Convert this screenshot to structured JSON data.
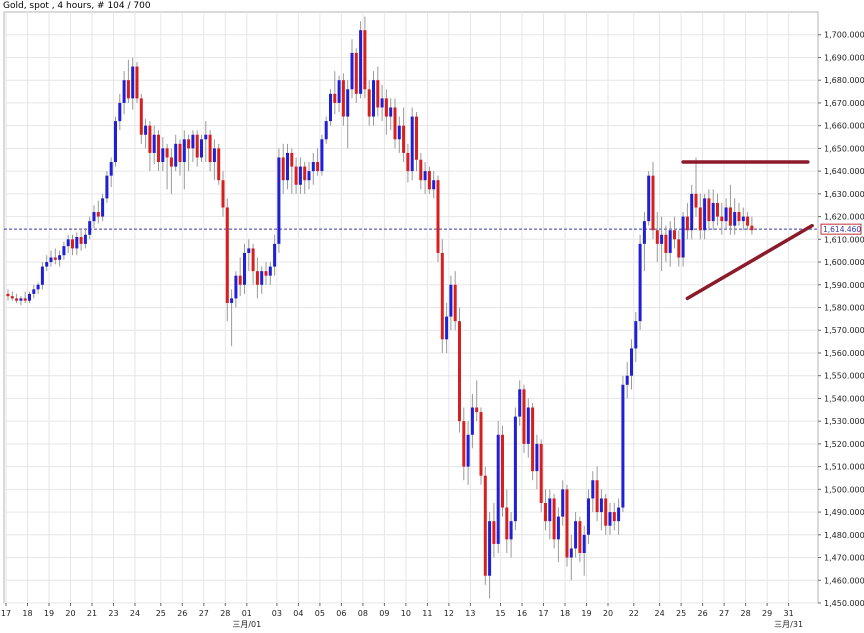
{
  "title": "Gold, spot , 4 hours, # 104 / 700",
  "colors": {
    "up": "#1f1fd6",
    "down": "#d81f1f",
    "wick": "#9a9a9a",
    "grid": "#e6e6e6",
    "price_line": "#3a3aa8",
    "trendline": "#8b1a2a",
    "current_label_border": "#c0303a"
  },
  "chart_data": {
    "type": "candlestick",
    "y_range": [
      1450,
      1710
    ],
    "y_ticks": [
      1450,
      1460,
      1470,
      1480,
      1490,
      1500,
      1510,
      1520,
      1530,
      1540,
      1550,
      1560,
      1570,
      1580,
      1590,
      1600,
      1610,
      1620,
      1630,
      1640,
      1650,
      1660,
      1670,
      1680,
      1690,
      1700
    ],
    "y_tick_labels": [
      "1,450.000",
      "1,460.000",
      "1,470.000",
      "1,480.000",
      "1,490.000",
      "1,500.000",
      "1,510.000",
      "1,520.000",
      "1,530.000",
      "1,540.000",
      "1,550.000",
      "1,560.000",
      "1,570.000",
      "1,580.000",
      "1,590.000",
      "1,600.000",
      "1,610.000",
      "1,620.000",
      "1,630.000",
      "1,640.000",
      "1,650.000",
      "1,660.000",
      "1,670.000",
      "1,680.000",
      "1,690.000",
      "1,700.000"
    ],
    "current_price": 1614.46,
    "current_price_label": "1,614.460",
    "x_day_labels": [
      "17",
      "18",
      "19",
      "20",
      "21",
      "23",
      "24",
      "25",
      "26",
      "27",
      "28",
      "01",
      "03",
      "04",
      "05",
      "06",
      "08",
      "09",
      "10",
      "11",
      "12",
      "13",
      "15",
      "16",
      "17",
      "18",
      "19",
      "20",
      "22",
      "24",
      "25",
      "26",
      "27",
      "28",
      "29",
      "31"
    ],
    "x_day_bar_index": [
      0,
      5,
      10,
      15,
      20,
      25,
      30,
      36,
      41,
      46,
      51,
      56,
      63,
      68,
      73,
      78,
      83,
      88,
      93,
      98,
      103,
      108,
      115,
      120,
      125,
      130,
      135,
      140,
      146,
      152,
      157,
      162,
      167,
      172,
      177,
      182
    ],
    "month_labels": [
      {
        "text": "三月/01",
        "bar": 56
      },
      {
        "text": "三月/31",
        "bar": 182
      }
    ],
    "bar_spacing_px": 4.3,
    "candles_ohlc": [
      [
        1586,
        1588,
        1583,
        1585
      ],
      [
        1585,
        1587,
        1583,
        1584
      ],
      [
        1584,
        1586,
        1582,
        1583
      ],
      [
        1583,
        1585,
        1581,
        1584
      ],
      [
        1584,
        1587,
        1582,
        1583
      ],
      [
        1583,
        1587,
        1582,
        1586
      ],
      [
        1586,
        1590,
        1584,
        1588
      ],
      [
        1588,
        1591,
        1586,
        1590
      ],
      [
        1590,
        1600,
        1588,
        1598
      ],
      [
        1598,
        1603,
        1596,
        1600
      ],
      [
        1600,
        1605,
        1598,
        1602
      ],
      [
        1602,
        1606,
        1599,
        1601
      ],
      [
        1601,
        1605,
        1598,
        1603
      ],
      [
        1603,
        1609,
        1601,
        1607
      ],
      [
        1607,
        1612,
        1604,
        1610
      ],
      [
        1610,
        1612,
        1603,
        1606
      ],
      [
        1606,
        1613,
        1603,
        1611
      ],
      [
        1611,
        1614,
        1605,
        1608
      ],
      [
        1608,
        1615,
        1606,
        1612
      ],
      [
        1612,
        1620,
        1610,
        1618
      ],
      [
        1618,
        1625,
        1615,
        1622
      ],
      [
        1622,
        1627,
        1617,
        1620
      ],
      [
        1620,
        1630,
        1618,
        1628
      ],
      [
        1628,
        1640,
        1626,
        1638
      ],
      [
        1638,
        1646,
        1633,
        1644
      ],
      [
        1644,
        1664,
        1642,
        1662
      ],
      [
        1662,
        1674,
        1658,
        1670
      ],
      [
        1670,
        1684,
        1665,
        1680
      ],
      [
        1680,
        1689,
        1670,
        1672
      ],
      [
        1672,
        1690,
        1667,
        1686
      ],
      [
        1686,
        1688,
        1670,
        1672
      ],
      [
        1672,
        1674,
        1652,
        1656
      ],
      [
        1656,
        1663,
        1650,
        1660
      ],
      [
        1660,
        1662,
        1640,
        1648
      ],
      [
        1648,
        1660,
        1643,
        1656
      ],
      [
        1656,
        1658,
        1640,
        1644
      ],
      [
        1644,
        1655,
        1640,
        1650
      ],
      [
        1650,
        1652,
        1632,
        1646
      ],
      [
        1646,
        1650,
        1630,
        1642
      ],
      [
        1642,
        1656,
        1640,
        1652
      ],
      [
        1652,
        1654,
        1638,
        1644
      ],
      [
        1644,
        1658,
        1632,
        1654
      ],
      [
        1654,
        1656,
        1640,
        1650
      ],
      [
        1650,
        1658,
        1644,
        1656
      ],
      [
        1656,
        1658,
        1642,
        1646
      ],
      [
        1646,
        1656,
        1644,
        1654
      ],
      [
        1654,
        1662,
        1644,
        1656
      ],
      [
        1656,
        1658,
        1640,
        1644
      ],
      [
        1644,
        1654,
        1636,
        1650
      ],
      [
        1650,
        1652,
        1634,
        1636
      ],
      [
        1636,
        1640,
        1620,
        1624
      ],
      [
        1624,
        1628,
        1574,
        1582
      ],
      [
        1582,
        1588,
        1563,
        1584
      ],
      [
        1584,
        1596,
        1580,
        1594
      ],
      [
        1594,
        1602,
        1585,
        1590
      ],
      [
        1590,
        1608,
        1586,
        1604
      ],
      [
        1604,
        1610,
        1596,
        1606
      ],
      [
        1606,
        1608,
        1590,
        1596
      ],
      [
        1596,
        1602,
        1584,
        1590
      ],
      [
        1590,
        1598,
        1586,
        1596
      ],
      [
        1596,
        1600,
        1590,
        1594
      ],
      [
        1594,
        1600,
        1590,
        1598
      ],
      [
        1598,
        1612,
        1594,
        1608
      ],
      [
        1608,
        1650,
        1604,
        1646
      ],
      [
        1646,
        1652,
        1630,
        1636
      ],
      [
        1636,
        1652,
        1632,
        1648
      ],
      [
        1648,
        1650,
        1630,
        1642
      ],
      [
        1642,
        1646,
        1630,
        1634
      ],
      [
        1634,
        1646,
        1630,
        1642
      ],
      [
        1642,
        1644,
        1630,
        1636
      ],
      [
        1636,
        1644,
        1632,
        1640
      ],
      [
        1640,
        1648,
        1634,
        1644
      ],
      [
        1644,
        1650,
        1638,
        1640
      ],
      [
        1640,
        1656,
        1638,
        1654
      ],
      [
        1654,
        1664,
        1652,
        1662
      ],
      [
        1662,
        1676,
        1660,
        1674
      ],
      [
        1674,
        1684,
        1665,
        1670
      ],
      [
        1670,
        1682,
        1666,
        1680
      ],
      [
        1680,
        1683,
        1660,
        1664
      ],
      [
        1664,
        1680,
        1650,
        1676
      ],
      [
        1676,
        1698,
        1672,
        1692
      ],
      [
        1692,
        1694,
        1670,
        1674
      ],
      [
        1674,
        1706,
        1672,
        1702
      ],
      [
        1702,
        1708,
        1672,
        1676
      ],
      [
        1676,
        1680,
        1660,
        1664
      ],
      [
        1664,
        1684,
        1660,
        1680
      ],
      [
        1680,
        1686,
        1664,
        1668
      ],
      [
        1668,
        1678,
        1662,
        1672
      ],
      [
        1672,
        1676,
        1656,
        1664
      ],
      [
        1664,
        1672,
        1658,
        1668
      ],
      [
        1668,
        1672,
        1650,
        1654
      ],
      [
        1654,
        1664,
        1648,
        1660
      ],
      [
        1660,
        1668,
        1644,
        1648
      ],
      [
        1648,
        1652,
        1635,
        1640
      ],
      [
        1640,
        1668,
        1636,
        1664
      ],
      [
        1664,
        1666,
        1640,
        1645
      ],
      [
        1645,
        1648,
        1632,
        1636
      ],
      [
        1636,
        1644,
        1630,
        1640
      ],
      [
        1640,
        1642,
        1630,
        1632
      ],
      [
        1632,
        1640,
        1628,
        1636
      ],
      [
        1636,
        1638,
        1600,
        1604
      ],
      [
        1604,
        1610,
        1560,
        1566
      ],
      [
        1566,
        1582,
        1560,
        1576
      ],
      [
        1576,
        1594,
        1570,
        1590
      ],
      [
        1590,
        1596,
        1570,
        1574
      ],
      [
        1574,
        1580,
        1525,
        1530
      ],
      [
        1530,
        1536,
        1504,
        1510
      ],
      [
        1510,
        1530,
        1502,
        1524
      ],
      [
        1524,
        1542,
        1518,
        1536
      ],
      [
        1536,
        1548,
        1530,
        1534
      ],
      [
        1534,
        1536,
        1502,
        1506
      ],
      [
        1506,
        1510,
        1458,
        1462
      ],
      [
        1462,
        1490,
        1452,
        1486
      ],
      [
        1486,
        1494,
        1470,
        1476
      ],
      [
        1476,
        1530,
        1472,
        1524
      ],
      [
        1524,
        1528,
        1488,
        1492
      ],
      [
        1492,
        1500,
        1472,
        1478
      ],
      [
        1478,
        1490,
        1470,
        1486
      ],
      [
        1486,
        1536,
        1482,
        1532
      ],
      [
        1532,
        1548,
        1528,
        1544
      ],
      [
        1544,
        1546,
        1516,
        1520
      ],
      [
        1520,
        1540,
        1514,
        1536
      ],
      [
        1536,
        1538,
        1504,
        1508
      ],
      [
        1508,
        1524,
        1500,
        1520
      ],
      [
        1520,
        1522,
        1490,
        1494
      ],
      [
        1494,
        1500,
        1482,
        1486
      ],
      [
        1486,
        1500,
        1478,
        1496
      ],
      [
        1496,
        1498,
        1474,
        1478
      ],
      [
        1478,
        1492,
        1468,
        1488
      ],
      [
        1488,
        1504,
        1484,
        1500
      ],
      [
        1500,
        1502,
        1466,
        1470
      ],
      [
        1470,
        1480,
        1460,
        1474
      ],
      [
        1474,
        1490,
        1470,
        1486
      ],
      [
        1486,
        1488,
        1468,
        1472
      ],
      [
        1472,
        1484,
        1462,
        1480
      ],
      [
        1480,
        1500,
        1476,
        1496
      ],
      [
        1496,
        1508,
        1490,
        1504
      ],
      [
        1504,
        1510,
        1486,
        1490
      ],
      [
        1490,
        1500,
        1482,
        1496
      ],
      [
        1496,
        1498,
        1480,
        1484
      ],
      [
        1484,
        1494,
        1480,
        1490
      ],
      [
        1490,
        1494,
        1482,
        1486
      ],
      [
        1486,
        1496,
        1480,
        1492
      ],
      [
        1492,
        1550,
        1490,
        1546
      ],
      [
        1546,
        1556,
        1540,
        1550
      ],
      [
        1550,
        1566,
        1544,
        1562
      ],
      [
        1562,
        1578,
        1556,
        1574
      ],
      [
        1574,
        1612,
        1570,
        1608
      ],
      [
        1608,
        1622,
        1596,
        1618
      ],
      [
        1618,
        1640,
        1616,
        1638
      ],
      [
        1638,
        1644,
        1610,
        1614
      ],
      [
        1614,
        1622,
        1600,
        1608
      ],
      [
        1608,
        1620,
        1596,
        1612
      ],
      [
        1612,
        1616,
        1600,
        1604
      ],
      [
        1604,
        1618,
        1598,
        1614
      ],
      [
        1614,
        1620,
        1606,
        1610
      ],
      [
        1610,
        1614,
        1598,
        1602
      ],
      [
        1602,
        1622,
        1598,
        1620
      ],
      [
        1620,
        1626,
        1610,
        1614
      ],
      [
        1614,
        1634,
        1610,
        1630
      ],
      [
        1630,
        1646,
        1620,
        1624
      ],
      [
        1624,
        1630,
        1610,
        1614
      ],
      [
        1614,
        1630,
        1610,
        1628
      ],
      [
        1628,
        1632,
        1614,
        1618
      ],
      [
        1618,
        1632,
        1614,
        1626
      ],
      [
        1626,
        1630,
        1616,
        1620
      ],
      [
        1620,
        1626,
        1612,
        1618
      ],
      [
        1618,
        1628,
        1614,
        1624
      ],
      [
        1624,
        1634,
        1612,
        1616
      ],
      [
        1616,
        1628,
        1612,
        1622
      ],
      [
        1622,
        1626,
        1616,
        1618
      ],
      [
        1618,
        1624,
        1614,
        1620
      ],
      [
        1620,
        1622,
        1614,
        1616
      ],
      [
        1616,
        1620,
        1612,
        1614
      ]
    ],
    "trendlines": [
      {
        "name": "resistance",
        "x1_bar": 157,
        "y1": 1644,
        "x2_bar": 186,
        "y2": 1644
      },
      {
        "name": "support",
        "x1_bar": 158,
        "y1": 1584,
        "x2_bar": 187,
        "y2": 1616
      }
    ]
  }
}
